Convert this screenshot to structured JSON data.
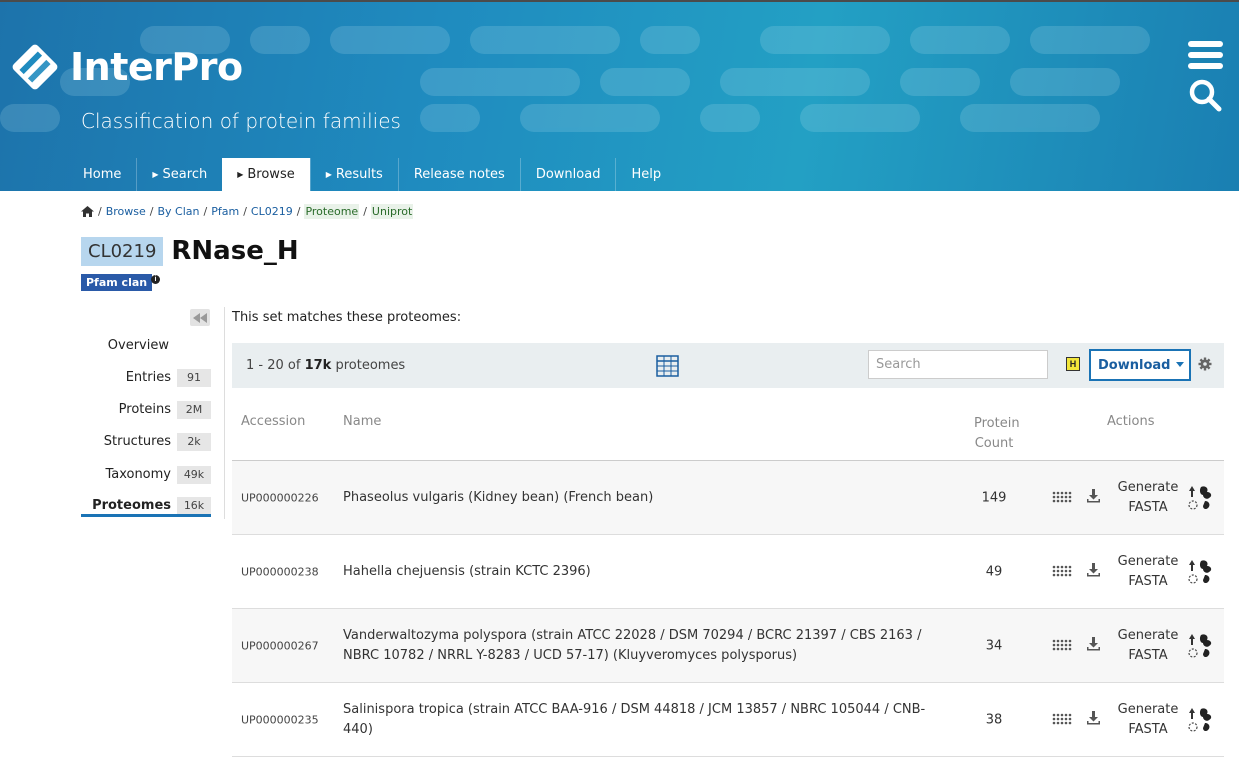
{
  "header": {
    "logo_text": "InterPro",
    "subtitle": "Classification of protein families",
    "nav": [
      {
        "label": "Home",
        "caret": false,
        "active": false
      },
      {
        "label": "Search",
        "caret": true,
        "active": false
      },
      {
        "label": "Browse",
        "caret": true,
        "active": true
      },
      {
        "label": "Results",
        "caret": true,
        "active": false
      },
      {
        "label": "Release notes",
        "caret": false,
        "active": false
      },
      {
        "label": "Download",
        "caret": false,
        "active": false
      },
      {
        "label": "Help",
        "caret": false,
        "active": false
      }
    ]
  },
  "breadcrumb": [
    "Browse",
    "By Clan",
    "Pfam",
    "CL0219",
    "Proteome",
    "Uniprot"
  ],
  "entry": {
    "accession": "CL0219",
    "title": "RNase_H",
    "type_badge": "Pfam clan"
  },
  "sidebar": [
    {
      "label": "Overview",
      "count": ""
    },
    {
      "label": "Entries",
      "count": "91"
    },
    {
      "label": "Proteins",
      "count": "2M"
    },
    {
      "label": "Structures",
      "count": "2k"
    },
    {
      "label": "Taxonomy",
      "count": "49k"
    },
    {
      "label": "Proteomes",
      "count": "16k",
      "active": true
    }
  ],
  "main": {
    "intro": "This set matches these proteomes:",
    "range_prefix": "1 - 20 of ",
    "range_total": "17k",
    "range_suffix": " proteomes",
    "search_placeholder": "Search",
    "download_label": "Download"
  },
  "table": {
    "headers": {
      "accession": "Accession",
      "name": "Name",
      "count_line1": "Protein",
      "count_line2": "Count",
      "actions": "Actions"
    },
    "generate_line1": "Generate",
    "generate_line2": "FASTA",
    "rows": [
      {
        "accession": "UP000000226",
        "name": "Phaseolus vulgaris (Kidney bean) (French bean)",
        "count": "149"
      },
      {
        "accession": "UP000000238",
        "name": "Hahella chejuensis (strain KCTC 2396)",
        "count": "49"
      },
      {
        "accession": "UP000000267",
        "name": "Vanderwaltozyma polyspora (strain ATCC 22028 / DSM 70294 / BCRC 21397 / CBS 2163 / NBRC 10782 / NRRL Y-8283 / UCD 57-17) (Kluyveromyces polysporus)",
        "count": "34"
      },
      {
        "accession": "UP000000235",
        "name": "Salinispora tropica (strain ATCC BAA-916 / DSM 44818 / JCM 13857 / NBRC 105044 / CNB-440)",
        "count": "38"
      }
    ]
  },
  "colors": {
    "header_blue": "#1f8bbf",
    "accent": "#1a73b5",
    "badge_blue": "#2a5aa8"
  }
}
